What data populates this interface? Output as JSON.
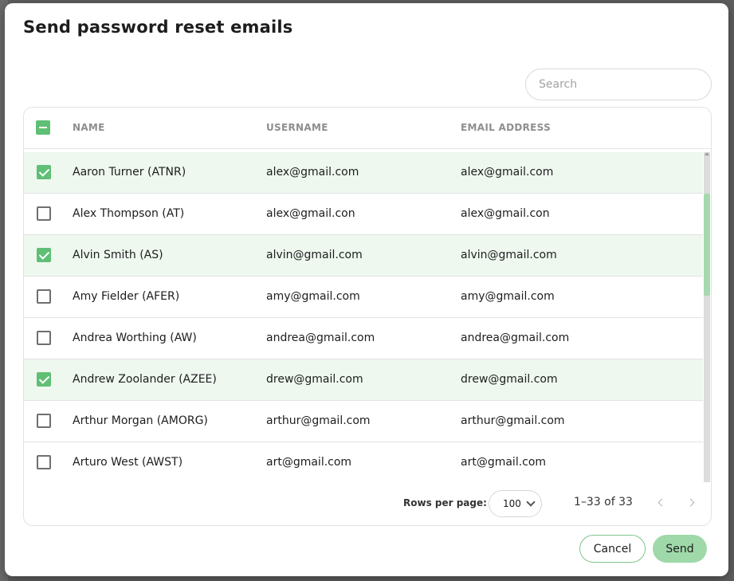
{
  "dialog": {
    "title": "Send password reset emails"
  },
  "search": {
    "placeholder": "Search",
    "value": ""
  },
  "table": {
    "columns": {
      "name": "NAME",
      "username": "USERNAME",
      "email": "EMAIL ADDRESS"
    },
    "select_all_state": "indeterminate",
    "rows": [
      {
        "name": "Aaron Turner (ATNR)",
        "username": "alex@gmail.com",
        "email": "alex@gmail.com",
        "selected": true
      },
      {
        "name": "Alex Thompson (AT)",
        "username": "alex@gmail.con",
        "email": "alex@gmail.con",
        "selected": false
      },
      {
        "name": "Alvin Smith (AS)",
        "username": "alvin@gmail.com",
        "email": "alvin@gmail.com",
        "selected": true
      },
      {
        "name": "Amy Fielder (AFER)",
        "username": "amy@gmail.com",
        "email": "amy@gmail.com",
        "selected": false
      },
      {
        "name": "Andrea Worthing (AW)",
        "username": "andrea@gmail.com",
        "email": "andrea@gmail.com",
        "selected": false
      },
      {
        "name": "Andrew Zoolander (AZEE)",
        "username": "drew@gmail.com",
        "email": "drew@gmail.com",
        "selected": true
      },
      {
        "name": "Arthur Morgan (AMORG)",
        "username": "arthur@gmail.com",
        "email": "arthur@gmail.com",
        "selected": false
      },
      {
        "name": "Arturo West (AWST)",
        "username": "art@gmail.com",
        "email": "art@gmail.com",
        "selected": false
      }
    ]
  },
  "pagination": {
    "rows_per_page_label": "Rows per page:",
    "rows_per_page_value": "100",
    "range": "1–33 of 33"
  },
  "actions": {
    "cancel_label": "Cancel",
    "send_label": "Send"
  },
  "colors": {
    "accent": "#5fbf75",
    "selected_row": "#eef8ef",
    "send_button": "#9fd8a9"
  }
}
